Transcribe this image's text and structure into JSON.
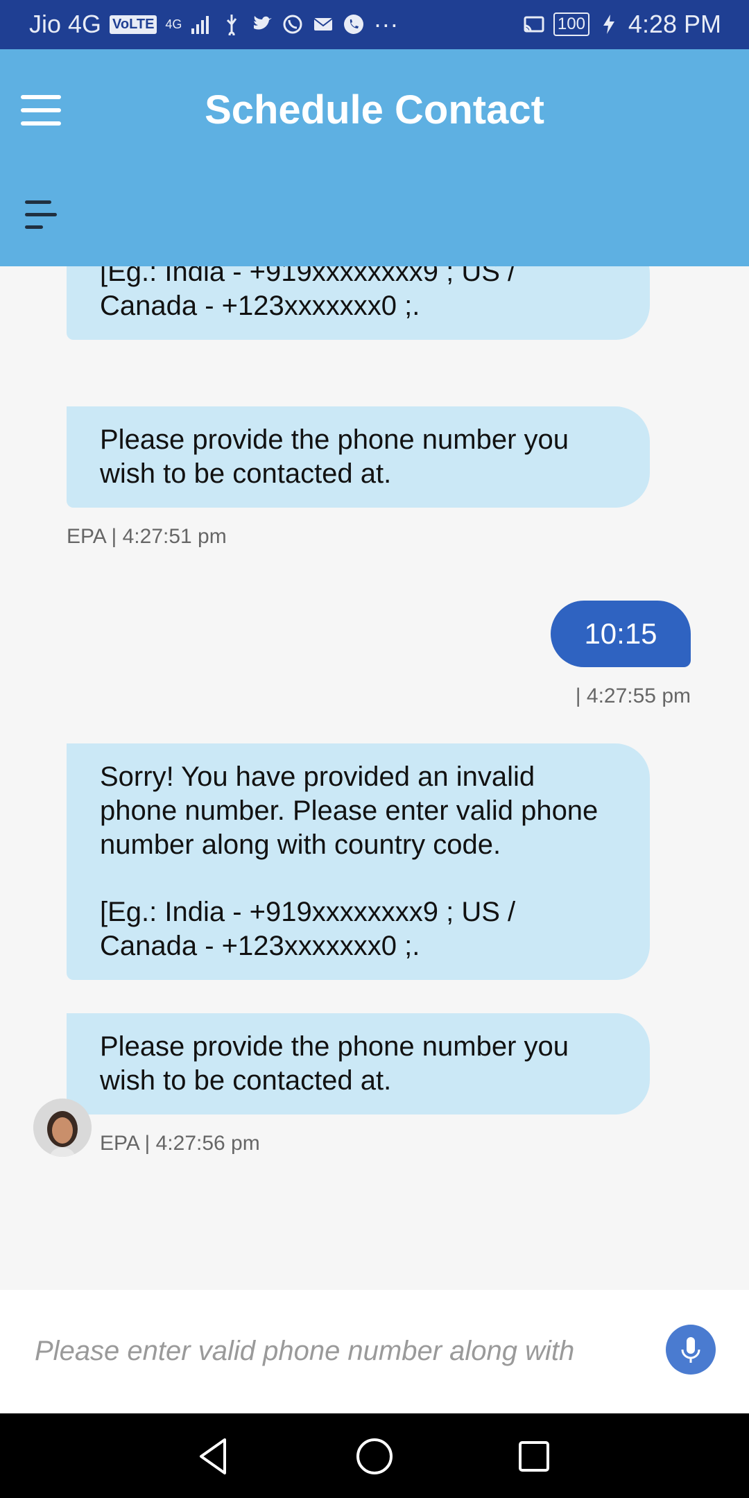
{
  "status_bar": {
    "carrier": "Jio 4G",
    "volte": "VoLTE",
    "network": "4G",
    "battery": "100",
    "time": "4:28 PM",
    "more": "···"
  },
  "header": {
    "title": "Schedule Contact"
  },
  "messages": {
    "m1": {
      "line1": "[Eg.: India - +919xxxxxxxx9 ; US /",
      "line2": "Canada - +123xxxxxxx0 ;."
    },
    "m2": {
      "line1": "Please provide the phone number you",
      "line2": "wish to be contacted at.",
      "meta": "EPA | 4:27:51 pm"
    },
    "m3": {
      "text": "10:15",
      "meta": "| 4:27:55 pm"
    },
    "m4": {
      "line1": "Sorry! You have provided an invalid",
      "line2": "phone number. Please enter valid phone",
      "line3": "number along with country code.",
      "line4": "[Eg.: India - +919xxxxxxxx9 ; US /",
      "line5": "Canada - +123xxxxxxx0 ;."
    },
    "m5": {
      "line1": "Please provide the phone number you",
      "line2": "wish to be contacted at.",
      "meta": "EPA | 4:27:56 pm"
    }
  },
  "input": {
    "placeholder": "Please enter valid phone number along with"
  },
  "colors": {
    "status_bar": "#1f3f93",
    "app_bar": "#5eb0e2",
    "bot_bubble": "#cbe8f6",
    "user_bubble": "#2f63c1",
    "mic_button": "#4a7bd0"
  }
}
